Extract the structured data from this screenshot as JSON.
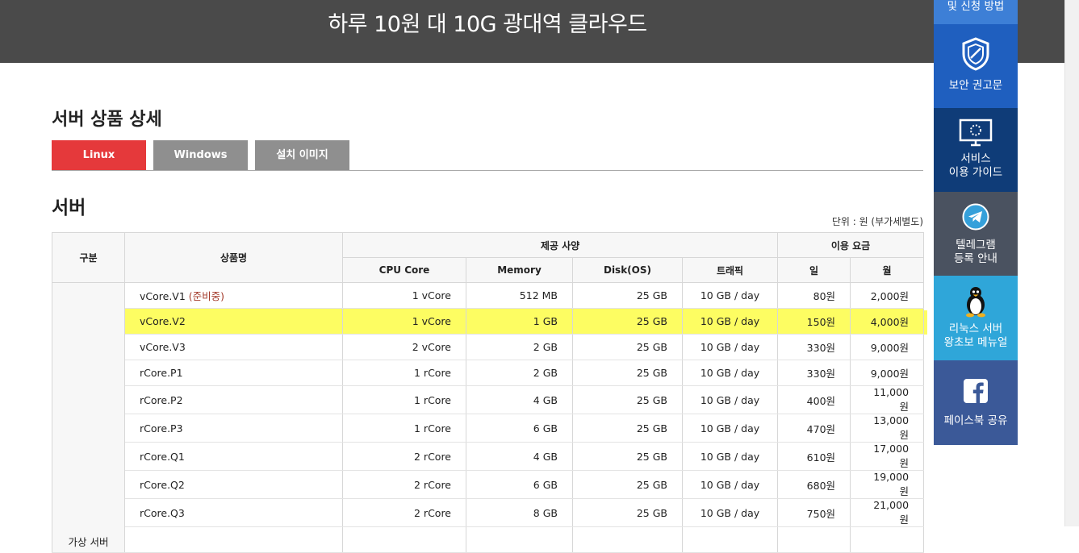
{
  "banner": {
    "title": "하루 10원 대 10G 광대역 클라우드"
  },
  "section": {
    "title": "서버 상품 상세"
  },
  "tabs": [
    {
      "label": "Linux",
      "active": true
    },
    {
      "label": "Windows",
      "active": false
    },
    {
      "label": "설치 이미지",
      "active": false
    }
  ],
  "subsection": {
    "title": "서버",
    "unit_note": "단위 : 원 (부가세별도)"
  },
  "table": {
    "headers": {
      "category": "구분",
      "product": "상품명",
      "spec_group": "제공 사양",
      "price_group": "이용 요금",
      "cpu": "CPU Core",
      "memory": "Memory",
      "disk": "Disk(OS)",
      "traffic": "트래픽",
      "day": "일",
      "month": "월"
    },
    "category_label": "가상 서버",
    "rows": [
      {
        "name": "vCore.V1",
        "badge": "(준비중)",
        "cpu": "1 vCore",
        "memory": "512 MB",
        "disk": "25 GB",
        "traffic": "10 GB / day",
        "day": "80원",
        "month": "2,000원",
        "highlight": false
      },
      {
        "name": "vCore.V2",
        "badge": "",
        "cpu": "1 vCore",
        "memory": "1 GB",
        "disk": "25 GB",
        "traffic": "10 GB / day",
        "day": "150원",
        "month": "4,000원",
        "highlight": true
      },
      {
        "name": "vCore.V3",
        "badge": "",
        "cpu": "2 vCore",
        "memory": "2 GB",
        "disk": "25 GB",
        "traffic": "10 GB / day",
        "day": "330원",
        "month": "9,000원",
        "highlight": false
      },
      {
        "name": "rCore.P1",
        "badge": "",
        "cpu": "1 rCore",
        "memory": "2 GB",
        "disk": "25 GB",
        "traffic": "10 GB / day",
        "day": "330원",
        "month": "9,000원",
        "highlight": false
      },
      {
        "name": "rCore.P2",
        "badge": "",
        "cpu": "1 rCore",
        "memory": "4 GB",
        "disk": "25 GB",
        "traffic": "10 GB / day",
        "day": "400원",
        "month": "11,000원",
        "highlight": false
      },
      {
        "name": "rCore.P3",
        "badge": "",
        "cpu": "1 rCore",
        "memory": "6 GB",
        "disk": "25 GB",
        "traffic": "10 GB / day",
        "day": "470원",
        "month": "13,000원",
        "highlight": false
      },
      {
        "name": "rCore.Q1",
        "badge": "",
        "cpu": "2 rCore",
        "memory": "4 GB",
        "disk": "25 GB",
        "traffic": "10 GB / day",
        "day": "610원",
        "month": "17,000원",
        "highlight": false
      },
      {
        "name": "rCore.Q2",
        "badge": "",
        "cpu": "2 rCore",
        "memory": "6 GB",
        "disk": "25 GB",
        "traffic": "10 GB / day",
        "day": "680원",
        "month": "19,000원",
        "highlight": false
      },
      {
        "name": "rCore.Q3",
        "badge": "",
        "cpu": "2 rCore",
        "memory": "8 GB",
        "disk": "25 GB",
        "traffic": "10 GB / day",
        "day": "750원",
        "month": "21,000원",
        "highlight": false
      }
    ]
  },
  "side_nav": [
    {
      "label": "및 신청 방법",
      "icon": "none",
      "color": "#3d7fd6"
    },
    {
      "label": "보안 권고문",
      "icon": "shield-icon",
      "color": "#1f5fbf"
    },
    {
      "label": "서비스 이용 가이드",
      "line1": "서비스",
      "line2": "이용 가이드",
      "icon": "monitor-icon",
      "color": "#0f3c78"
    },
    {
      "label": "텔레그램 등록 안내",
      "line1": "텔레그램",
      "line2": "등록 안내",
      "icon": "telegram-icon",
      "color": "#4a5260"
    },
    {
      "label": "리눅스 서버 왕초보 메뉴얼",
      "line1": "리눅스 서버",
      "line2": "왕초보 메뉴얼",
      "icon": "linux-penguin-icon",
      "color": "#2fa6d9"
    },
    {
      "label": "페이스북 공유",
      "icon": "facebook-icon",
      "color": "#3b5998"
    }
  ]
}
